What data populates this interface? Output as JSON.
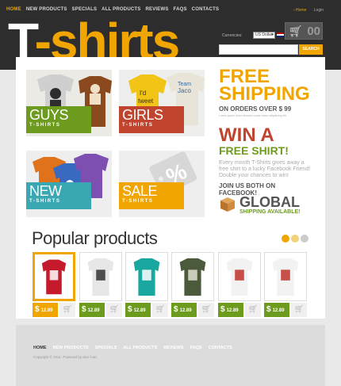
{
  "nav": {
    "items": [
      "HOME",
      "NEW PRODUCTS",
      "SPECIALS",
      "ALL PRODUCTS",
      "REVIEWS",
      "FAQS",
      "CONTACTS"
    ],
    "active": "HOME"
  },
  "toplinks": {
    "home": "› Home",
    "login": "Login"
  },
  "logo": {
    "first": "T",
    "rest": "-shirts"
  },
  "currency": {
    "label": "Currencies:",
    "selected": "US Dollar"
  },
  "cart": {
    "count": "00",
    "icon": "cart-icon"
  },
  "search": {
    "placeholder": "",
    "button": "SEARCH"
  },
  "banners": [
    {
      "big": "GUYS",
      "small": "T-SHIRTS",
      "tag_color": "#6d9b1e"
    },
    {
      "big": "GIRLS",
      "small": "T-SHIRTS",
      "tag_color": "#c0442e"
    },
    {
      "big": "NEW",
      "small": "T-SHIRTS",
      "tag_color": "#3aa8b3"
    },
    {
      "big": "SALE",
      "small": "T-SHIRTS",
      "tag_color": "#f0a500"
    }
  ],
  "promo": {
    "free": "FREE",
    "shipping": "SHIPPING",
    "orders": "ON ORDERS OVER $ 99",
    "fine": "Lorem ipsum dolor sit amet conse ctetur adipisicing elit"
  },
  "win": {
    "line1": "WIN A",
    "line2": "FREE SHIRT!",
    "text": "Every month T-Shirts gives away a free shirt to a lucky Facebook Friend! Double your chances to win!",
    "join": "JOIN US BOTH ON FACEBOOK!"
  },
  "global": {
    "title": "GLOBAL",
    "subtitle": "SHIPPING AVAILABLE!"
  },
  "popular": {
    "title": "Popular products",
    "dots": [
      "#f0a500",
      "#f0d37a",
      "#cccccc"
    ]
  },
  "products": [
    {
      "price": "12.89",
      "shirt": "#c41a2b",
      "print": "#ffffff",
      "selected": true
    },
    {
      "price": "12.89",
      "shirt": "#e7e7e7",
      "print": "#333333",
      "selected": false
    },
    {
      "price": "12.89",
      "shirt": "#1aa7a0",
      "print": "#ffffff",
      "selected": false
    },
    {
      "price": "12.89",
      "shirt": "#4a5a3a",
      "print": "#e0e0d0",
      "selected": false
    },
    {
      "price": "12.89",
      "shirt": "#f2f2f2",
      "print": "#c0332b",
      "selected": false
    },
    {
      "price": "12.89",
      "shirt": "#f2f2f2",
      "print": "#c0332b",
      "selected": false
    }
  ],
  "currency_symbol": "$",
  "footer": {
    "nav": [
      "HOME",
      "NEW PRODUCTS",
      "SPECIALS",
      "ALL PRODUCTS",
      "REVIEWS",
      "FAQS",
      "CONTACTS"
    ],
    "copyright": "Copyright © 2011. Powered by Zen Cart"
  }
}
